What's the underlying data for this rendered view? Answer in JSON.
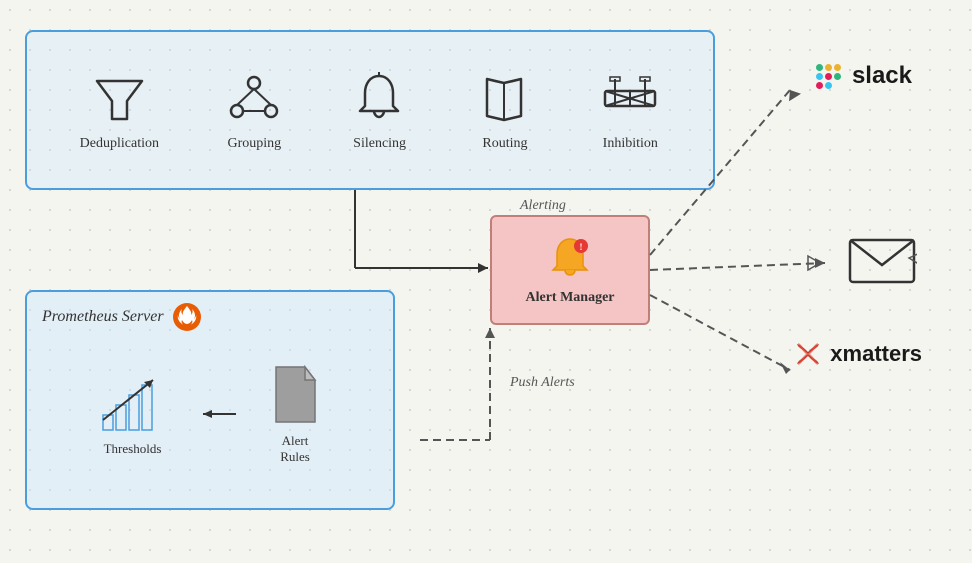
{
  "features": [
    {
      "id": "deduplication",
      "label": "Deduplication",
      "icon": "funnel"
    },
    {
      "id": "grouping",
      "label": "Grouping",
      "icon": "nodes"
    },
    {
      "id": "silencing",
      "label": "Silencing",
      "icon": "bell"
    },
    {
      "id": "routing",
      "label": "Routing",
      "icon": "book"
    },
    {
      "id": "inhibition",
      "label": "Inhibition",
      "icon": "barrier"
    }
  ],
  "alertmanager": {
    "title": "Alert Manager",
    "subtitle": "Alerting"
  },
  "prometheus": {
    "title": "Prometheus Server"
  },
  "components": {
    "thresholds": "Thresholds",
    "alert_rules": "Alert Rules",
    "push_alerts": "Push Alerts"
  },
  "integrations": {
    "slack": "slack",
    "xmatters": "xmatters"
  }
}
